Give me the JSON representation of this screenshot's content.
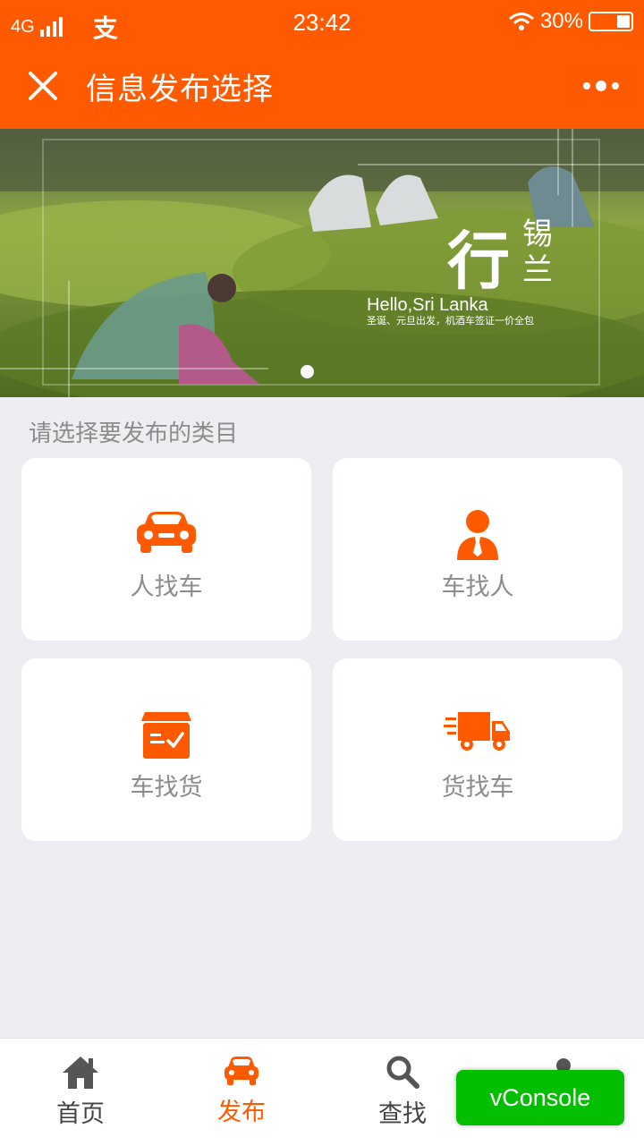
{
  "status_bar": {
    "network": "4G",
    "app_glyph": "支",
    "time": "23:42",
    "battery": "30%",
    "battery_level": 0.3
  },
  "nav": {
    "title": "信息发布选择"
  },
  "banner": {
    "brand_main": "行",
    "brand_side": "锡兰",
    "brand_latin": "Hello,Sri Lanka",
    "brand_sub": "圣诞、元旦出发，机酒车签证一价全包"
  },
  "section_label": "请选择要发布的类目",
  "categories": [
    {
      "label": "人找车",
      "icon": "car-icon"
    },
    {
      "label": "车找人",
      "icon": "person-icon"
    },
    {
      "label": "车找货",
      "icon": "cargo-box-icon"
    },
    {
      "label": "货找车",
      "icon": "truck-icon"
    }
  ],
  "tabs": [
    {
      "label": "首页",
      "icon": "home-icon",
      "active": false
    },
    {
      "label": "发布",
      "icon": "car-icon",
      "active": true
    },
    {
      "label": "查找",
      "icon": "search-icon",
      "active": false
    }
  ],
  "vconsole_label": "vConsole",
  "colors": {
    "brand": "#ff5a00",
    "background": "#edeef2",
    "vconsole": "#04be02"
  }
}
